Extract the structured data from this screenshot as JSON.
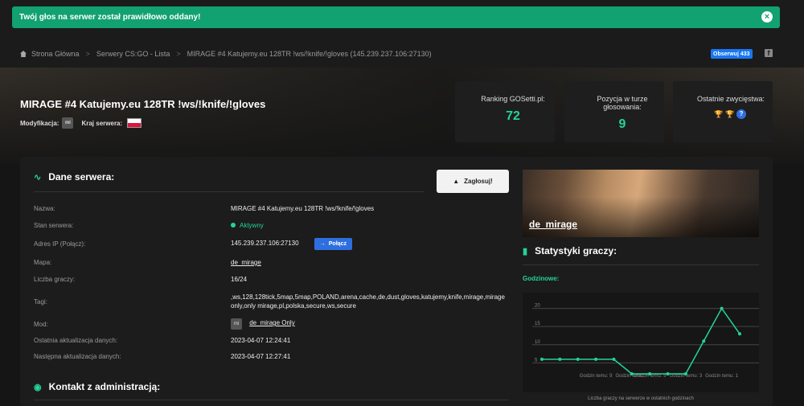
{
  "alert": {
    "message": "Twój głos na serwer został prawidłowo oddany!",
    "close": "×"
  },
  "breadcrumb": {
    "items": [
      "Strona Główna",
      "Serwery CS:GO - Lista",
      "MIRAGE #4 Katujemy.eu 128TR !ws/!knife/!gloves (145.239.237.106:27130)"
    ],
    "sep": ">"
  },
  "social": {
    "fb_like": "Obserwuj 433",
    "fb_icon": "f"
  },
  "server": {
    "title": "MIRAGE #4 Katujemy.eu 128TR !ws/!knife/!gloves",
    "mod_label": "Modyfikacja:",
    "mod_badge": "mi",
    "country_label": "Kraj serwera:"
  },
  "stats": {
    "ranking_label": "Ranking GOSetti.pl:",
    "ranking_value": "72",
    "position_label": "Pozycja w turze głosowania:",
    "position_value": "9",
    "wins_label": "Ostatnie zwycięstwa:",
    "trophy_q": "?"
  },
  "details": {
    "heading": "Dane serwera:",
    "vote_button": "Zagłosuj!",
    "rows": {
      "name": {
        "k": "Nazwa:",
        "v": "MIRAGE #4 Katujemy.eu 128TR !ws/!knife/!gloves"
      },
      "status": {
        "k": "Stan serwera:",
        "v": "Aktywny"
      },
      "ip": {
        "k": "Adres IP (Połącz):",
        "v": "145.239.237.106:27130",
        "btn": "Połącz"
      },
      "map": {
        "k": "Mapa:",
        "v": "de_mirage"
      },
      "players": {
        "k": "Liczba graczy:",
        "v": "16/24"
      },
      "tags": {
        "k": "Tagi:",
        "v": ",ws,128,128tick,5map,5map,POLAND,arena,cache,de,dust,gloves,katujemy,knife,mirage,mirage only,only mirage,pl,polska,secure,ws,secure"
      },
      "mod": {
        "k": "Mod:",
        "badge": "mi",
        "v": "de_mirage Only"
      },
      "last_update": {
        "k": "Ostatnia aktualizacja danych:",
        "v": "2023-04-07 12:24:41"
      },
      "next_update": {
        "k": "Następna aktualizacja danych:",
        "v": "2023-04-07 12:27:41"
      }
    }
  },
  "contact": {
    "heading": "Kontakt z administracją:"
  },
  "map_card": {
    "name": "de_mirage"
  },
  "player_stats": {
    "heading": "Statystyki graczy:",
    "sub": "Godzinowe:",
    "caption": "Liczba graczy na serwerze w ostatnich godzinach",
    "colors": {
      "line": "#24d39a",
      "grid": "#444444",
      "label": "#888888"
    }
  },
  "chart_data": {
    "type": "line",
    "x": [
      "",
      "",
      "",
      "",
      "",
      "",
      "",
      "",
      "",
      "",
      "",
      ""
    ],
    "x_labels_shown": [
      "Godzin temu: 9",
      "Godzin temu: 7",
      "Godzin temu: 5",
      "Godzin temu: 3",
      "Godzin temu: 1"
    ],
    "x_label_idx": [
      3,
      5,
      6,
      8,
      10
    ],
    "values": [
      6,
      6,
      6,
      6,
      6,
      2,
      2,
      2,
      2,
      11,
      20,
      13
    ],
    "yticks": [
      5,
      10,
      15,
      20
    ],
    "ylim": [
      0,
      23
    ],
    "grid": true
  }
}
